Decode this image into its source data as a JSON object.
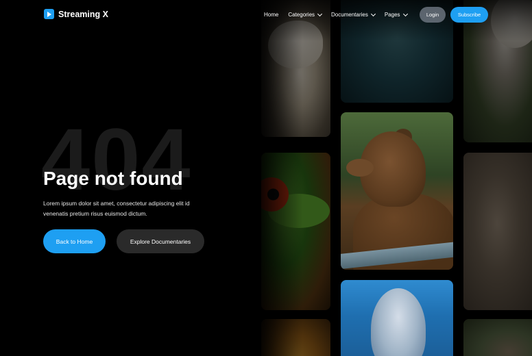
{
  "brand": {
    "name": "Streaming X",
    "accent": "#1e9ff2"
  },
  "nav": {
    "items": [
      {
        "label": "Home",
        "has_dropdown": false
      },
      {
        "label": "Categories",
        "has_dropdown": true
      },
      {
        "label": "Documentaries",
        "has_dropdown": true
      },
      {
        "label": "Pages",
        "has_dropdown": true
      }
    ],
    "login_label": "Login",
    "subscribe_label": "Subscribe"
  },
  "hero": {
    "background_code": "404",
    "title": "Page not found",
    "description": "Lorem ipsum dolor sit amet, consectetur adipiscing elit id venenatis pretium risus euismod dictum.",
    "primary_button": "Back to Home",
    "secondary_button": "Explore Documentaries"
  },
  "gallery": {
    "tiles": [
      {
        "subject": "polar-bear",
        "highlighted": false
      },
      {
        "subject": "sea-turtle",
        "highlighted": false
      },
      {
        "subject": "owl",
        "highlighted": false
      },
      {
        "subject": "tree-frog",
        "highlighted": false
      },
      {
        "subject": "brown-bear",
        "highlighted": true
      },
      {
        "subject": "driftwood",
        "highlighted": false
      },
      {
        "subject": "lion",
        "highlighted": false
      },
      {
        "subject": "dolphin",
        "highlighted": true
      },
      {
        "subject": "monkey",
        "highlighted": false
      }
    ]
  }
}
